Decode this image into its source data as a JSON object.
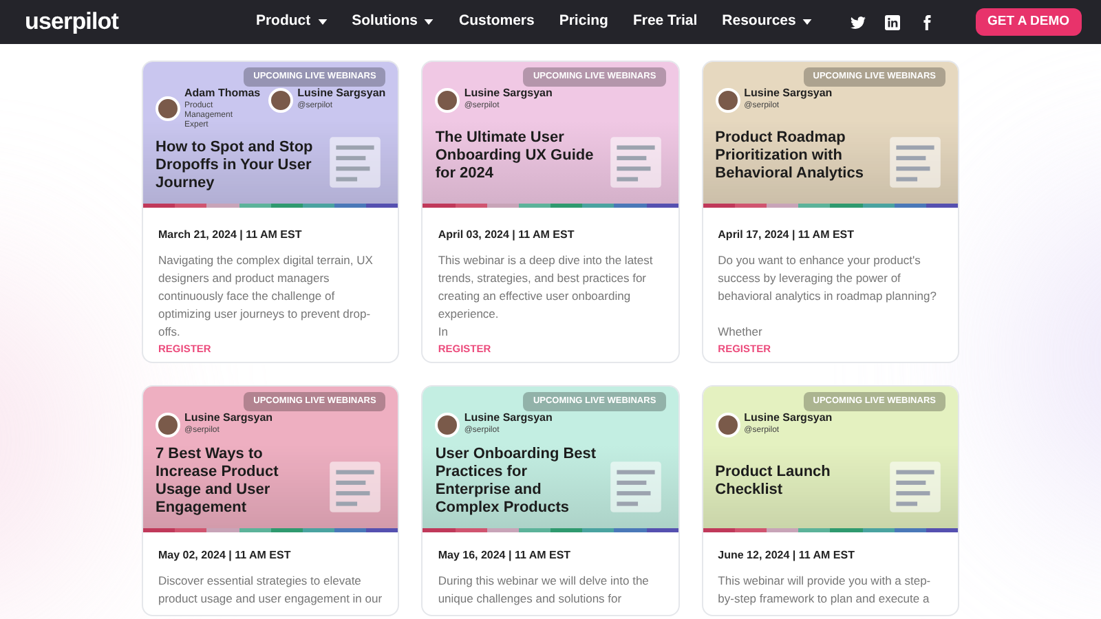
{
  "nav": {
    "logo": "userpilot",
    "menu": [
      {
        "label": "Product",
        "has_dropdown": true
      },
      {
        "label": "Solutions",
        "has_dropdown": true
      },
      {
        "label": "Customers",
        "has_dropdown": false
      },
      {
        "label": "Pricing",
        "has_dropdown": false
      },
      {
        "label": "Free Trial",
        "has_dropdown": false
      },
      {
        "label": "Resources",
        "has_dropdown": true
      }
    ],
    "social": [
      {
        "kind": "twitter"
      },
      {
        "kind": "linkedin"
      },
      {
        "kind": "facebook"
      }
    ],
    "cta": "GET A DEMO"
  },
  "cards": [
    {
      "color": "#c9c6ef",
      "badge": "UPCOMING LIVE WEBINARS",
      "speakers": [
        {
          "name": "Adam Thomas",
          "role": "Product Management Expert"
        },
        {
          "name": "Lusine Sargsyan",
          "role": "@serpilot"
        }
      ],
      "title": "How to Spot and Stop Dropoffs in Your User Journey",
      "date": "March 21, 2024 | 11 AM EST",
      "description": "Navigating the complex digital terrain, UX designers and product managers continuously face the challenge of optimizing user journeys to prevent drop-offs.",
      "link": "REGISTER"
    },
    {
      "color": "#f0c8e4",
      "badge": "UPCOMING LIVE WEBINARS",
      "speakers": [
        {
          "name": "Lusine Sargsyan",
          "role": "@serpilot"
        }
      ],
      "title": "The Ultimate User Onboarding UX Guide for 2024",
      "date": "April 03, 2024 | 11 AM EST",
      "description": "This webinar is a deep dive into the latest trends, strategies, and best practices for creating an effective user onboarding experience.\nIn",
      "link": "REGISTER"
    },
    {
      "color": "#e6d8bf",
      "badge": "UPCOMING LIVE WEBINARS",
      "speakers": [
        {
          "name": "Lusine Sargsyan",
          "role": "@serpilot"
        }
      ],
      "title": "Product Roadmap Prioritization with Behavioral Analytics",
      "date": "April 17, 2024 | 11 AM EST",
      "description": "Do you want to enhance your product's success by leveraging the power of behavioral analytics in roadmap planning?\n\nWhether",
      "link": "REGISTER"
    },
    {
      "color": "#eeafc1",
      "badge": "UPCOMING LIVE WEBINARS",
      "speakers": [
        {
          "name": "Lusine Sargsyan",
          "role": "@serpilot"
        }
      ],
      "title": "7 Best Ways to Increase Product Usage and User Engagement",
      "date": "May 02, 2024 | 11 AM EST",
      "description": "Discover essential strategies to elevate product usage and user engagement in our"
    },
    {
      "color": "#c3eee2",
      "badge": "UPCOMING LIVE WEBINARS",
      "speakers": [
        {
          "name": "Lusine Sargsyan",
          "role": "@serpilot"
        }
      ],
      "title": "User Onboarding Best Practices for Enterprise and Complex Products",
      "date": "May 16, 2024 | 11 AM EST",
      "description": "During this webinar we will delve into the unique challenges and solutions for"
    },
    {
      "color": "#e4f1c0",
      "badge": "UPCOMING LIVE WEBINARS",
      "speakers": [
        {
          "name": "Lusine Sargsyan",
          "role": "@serpilot"
        }
      ],
      "title": "Product Launch Checklist",
      "date": "June 12, 2024 | 11 AM EST",
      "description": "This webinar will provide you with a step-by-step framework to plan and execute a"
    }
  ]
}
